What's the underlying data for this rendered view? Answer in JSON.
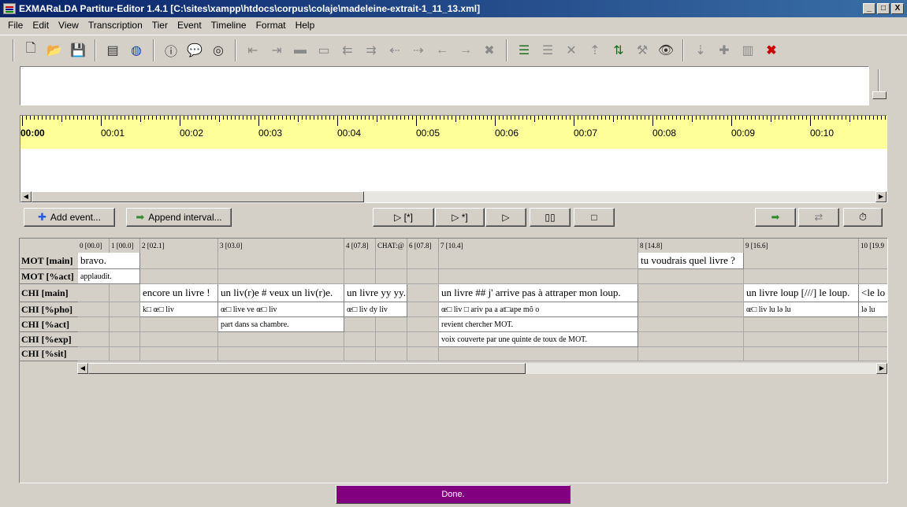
{
  "window": {
    "title": "EXMARaLDA Partitur-Editor 1.4.1 [C:\\sites\\xampp\\htdocs\\corpus\\colaje\\madeleine-extrait-1_11_13.xml]",
    "minimize": "_",
    "maximize": "□",
    "close": "X"
  },
  "menu": [
    "File",
    "Edit",
    "View",
    "Transcription",
    "Tier",
    "Event",
    "Timeline",
    "Format",
    "Help"
  ],
  "timeline": {
    "labels": [
      "00:00",
      "00:01",
      "00:02",
      "00:03",
      "00:04",
      "00:05",
      "00:06",
      "00:07",
      "00:08",
      "00:09",
      "00:10"
    ]
  },
  "buttons": {
    "add_event": "Add event...",
    "append_interval": "Append interval...",
    "play_star": "▷ [*]",
    "play_to_star": "▷ *]",
    "play": "▷",
    "pause": "▯▯",
    "stop": "□"
  },
  "partitur": {
    "columns": [
      {
        "label": "0 [00.0]"
      },
      {
        "label": "1 [00.0]"
      },
      {
        "label": "2 [02.1]"
      },
      {
        "label": "3 [03.0]"
      },
      {
        "label": "4 [07.8]"
      },
      {
        "label": "CHAT:@"
      },
      {
        "label": "6 [07.8]"
      },
      {
        "label": "7 [10.4]"
      },
      {
        "label": "8 [14.8]"
      },
      {
        "label": "9 [16.6]"
      },
      {
        "label": "10 [19.9"
      }
    ],
    "tiers": [
      {
        "label": "MOT [main]",
        "kind": "main",
        "events": [
          {
            "start": 0,
            "end": 2,
            "text": "bravo."
          },
          {
            "start": 8,
            "end": 9,
            "text": "tu voudrais quel livre ?"
          }
        ]
      },
      {
        "label": "MOT [%act]",
        "kind": "sub",
        "events": [
          {
            "start": 0,
            "end": 2,
            "text": "applaudit."
          }
        ]
      },
      {
        "label": "CHI [main]",
        "kind": "main",
        "events": [
          {
            "start": 2,
            "end": 3,
            "text": "encore un livre !"
          },
          {
            "start": 3,
            "end": 4,
            "text": "un liv(r)e # veux un liv(r)e."
          },
          {
            "start": 4,
            "end": 6,
            "text": "un livre yy yy."
          },
          {
            "start": 7,
            "end": 8,
            "text": "un livre ## j' arrive pas à attraper mon loup."
          },
          {
            "start": 9,
            "end": 10,
            "text": "un livre loup [///] le loup."
          },
          {
            "start": 10,
            "end": 11,
            "text": "<le lo"
          }
        ]
      },
      {
        "label": "CHI [%pho]",
        "kind": "sub",
        "events": [
          {
            "start": 2,
            "end": 3,
            "text": "k□ œ□ liv"
          },
          {
            "start": 3,
            "end": 4,
            "text": "œ□ live ve œ□ liv"
          },
          {
            "start": 4,
            "end": 6,
            "text": "œ□ liv dy liv"
          },
          {
            "start": 7,
            "end": 8,
            "text": "œ□ liv □ ariv pa a at□ape mõ o"
          },
          {
            "start": 9,
            "end": 10,
            "text": "œ□ liv lu lə lu"
          },
          {
            "start": 10,
            "end": 11,
            "text": "lə lu"
          }
        ]
      },
      {
        "label": "CHI [%act]",
        "kind": "sub",
        "events": [
          {
            "start": 3,
            "end": 4,
            "text": "part dans sa chambre."
          },
          {
            "start": 7,
            "end": 8,
            "text": "revient chercher MOT."
          }
        ]
      },
      {
        "label": "CHI [%exp]",
        "kind": "sub",
        "events": [
          {
            "start": 7,
            "end": 8,
            "text": "voix couverte par une quinte de toux de MOT."
          }
        ]
      },
      {
        "label": "CHI [%sit]",
        "kind": "sub",
        "events": []
      }
    ]
  },
  "status": "Done."
}
